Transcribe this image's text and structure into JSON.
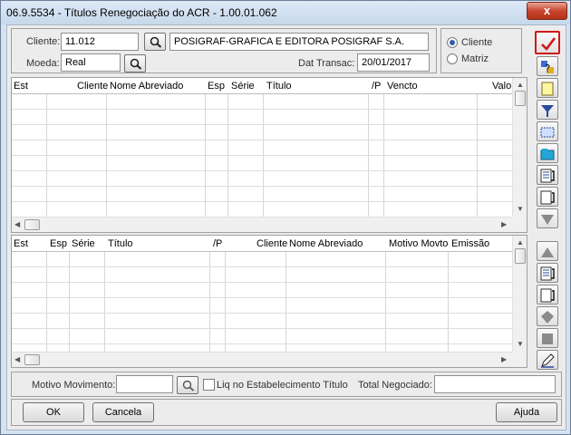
{
  "window": {
    "title": "06.9.5534 - Títulos Renegociação do ACR - 1.00.01.062",
    "close_label": "x"
  },
  "header": {
    "cliente_label": "Cliente:",
    "cliente_code": "11.012",
    "cliente_name": "POSIGRAF-GRAFICA E EDITORA POSIGRAF S.A.",
    "moeda_label": "Moeda:",
    "moeda_value": "Real",
    "dat_transac_label": "Dat Transac:",
    "dat_transac_value": "20/01/2017",
    "radio_cliente": "Cliente",
    "radio_matriz": "Matriz",
    "selected_radio": "Cliente"
  },
  "grid_top": {
    "columns": [
      "Est",
      "Cliente",
      "Nome Abreviado",
      "Esp",
      "Série",
      "Título",
      "/P",
      "Vencto",
      "Valo"
    ]
  },
  "grid_bottom": {
    "columns": [
      "Est",
      "Esp",
      "Série",
      "Título",
      "/P",
      "Cliente",
      "Nome Abreviado",
      "Motivo Movto",
      "Emissão"
    ]
  },
  "footer": {
    "motivo_label": "Motivo Movimento:",
    "motivo_value": "",
    "liq_label": "Liq no Estabelecimento Título",
    "total_label": "Total Negociado:",
    "total_value": ""
  },
  "buttons": {
    "ok": "OK",
    "cancel": "Cancela",
    "help": "Ajuda"
  },
  "toolbar_icons": [
    "confirm-check-icon",
    "question-help-icon",
    "note-icon",
    "filter-icon",
    "select-range-icon",
    "folder-icon",
    "list-arrow-icon",
    "page-arrow-icon",
    "move-down-icon",
    "move-up-icon",
    "list-arrow-icon",
    "page-arrow-icon",
    "diamond-icon",
    "square-icon",
    "edit-pen-icon"
  ],
  "colors": {
    "accent_red": "#d01818",
    "title_bar": "#c7d8ec",
    "window_bg": "#ececec"
  }
}
